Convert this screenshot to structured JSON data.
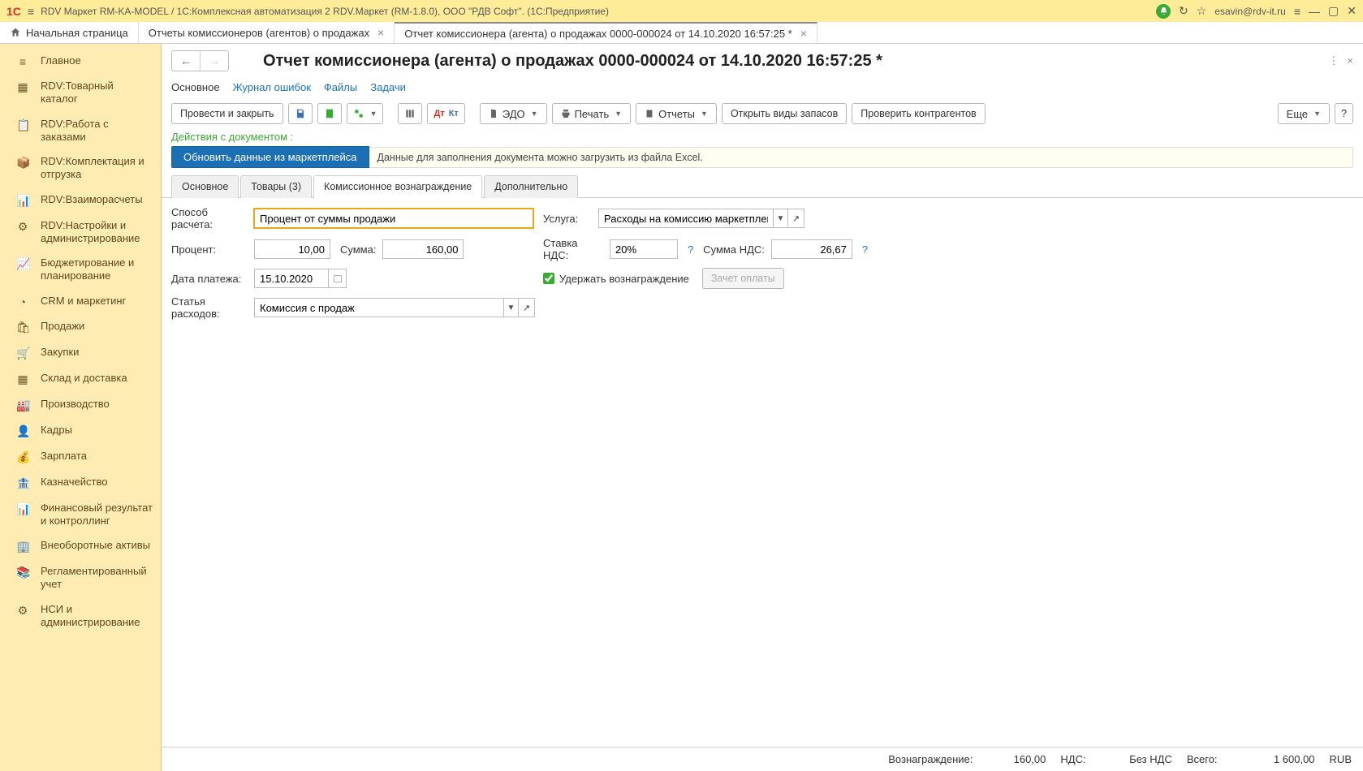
{
  "titlebar": {
    "app_title": "RDV Маркет RM-KA-MODEL / 1С:Комплексная автоматизация 2 RDV.Маркет (RM-1.8.0), ООО \"РДВ Софт\".  (1С:Предприятие)",
    "user": "esavin@rdv-it.ru"
  },
  "tabs": {
    "home": "Начальная страница",
    "list": "Отчеты комиссионеров (агентов) о продажах",
    "doc": "Отчет комиссионера (агента) о продажах 0000-000024 от 14.10.2020 16:57:25 *"
  },
  "sidebar": [
    "Главное",
    "RDV:Товарный каталог",
    "RDV:Работа с заказами",
    "RDV:Комплектация и отгрузка",
    "RDV:Взаиморасчеты",
    "RDV:Настройки и администрирование",
    "Бюджетирование и планирование",
    "CRM и маркетинг",
    "Продажи",
    "Закупки",
    "Склад и доставка",
    "Производство",
    "Кадры",
    "Зарплата",
    "Казначейство",
    "Финансовый результат и контроллинг",
    "Внеоборотные активы",
    "Регламентированный учет",
    "НСИ и администрирование"
  ],
  "doc": {
    "title": "Отчет комиссионера (агента) о продажах 0000-000024 от 14.10.2020 16:57:25 *",
    "subnav": [
      "Основное",
      "Журнал ошибок",
      "Файлы",
      "Задачи"
    ],
    "toolbar": {
      "post_close": "Провести и закрыть",
      "edo": "ЭДО",
      "print": "Печать",
      "reports": "Отчеты",
      "open_stocks": "Открыть виды запасов",
      "check_contragents": "Проверить контрагентов",
      "more": "Еще"
    },
    "section_label": "Действия с документом :",
    "update_btn": "Обновить данные из маркетплейса",
    "update_info": "Данные для заполнения документа можно загрузить из файла Excel.",
    "form_tabs": [
      "Основное",
      "Товары (3)",
      "Комиссионное вознаграждение",
      "Дополнительно"
    ],
    "form": {
      "method_label": "Способ расчета:",
      "method_value": "Процент от суммы продажи",
      "service_label": "Услуга:",
      "service_value": "Расходы на комиссию маркетплейсов",
      "percent_label": "Процент:",
      "percent_value": "10,00",
      "amount_label": "Сумма:",
      "amount_value": "160,00",
      "vat_rate_label": "Ставка НДС:",
      "vat_rate_value": "20%",
      "vat_sum_label": "Сумма НДС:",
      "vat_sum_value": "26,67",
      "date_label": "Дата платежа:",
      "date_value": "15.10.2020",
      "withhold_label": "Удержать вознаграждение",
      "offset_label": "Зачет оплаты",
      "expense_label": "Статья расходов:",
      "expense_value": "Комиссия с продаж"
    }
  },
  "status": {
    "reward_label": "Вознаграждение:",
    "reward_value": "160,00",
    "vat_label": "НДС:",
    "vat_value": "Без НДС",
    "total_label": "Всего:",
    "total_value": "1 600,00",
    "currency": "RUB"
  }
}
